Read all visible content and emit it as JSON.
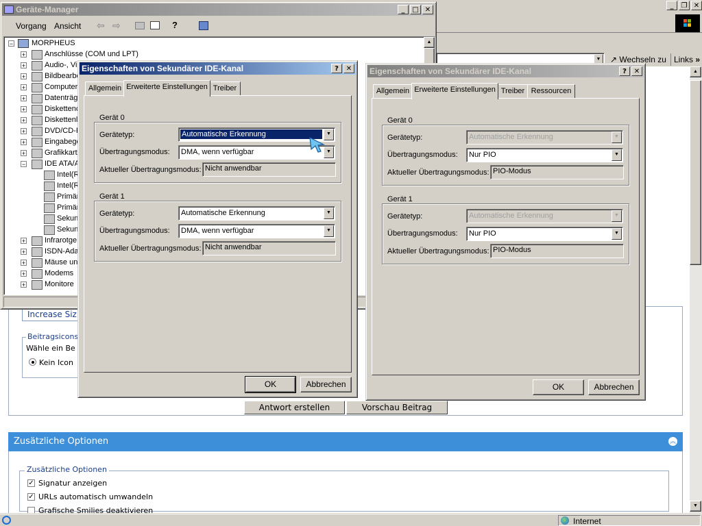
{
  "device_manager": {
    "title": "Geräte-Manager",
    "menu": [
      "Vorgang",
      "Ansicht"
    ],
    "tree": {
      "root": "MORPHEUS",
      "items": [
        "Anschlüsse (COM und LPT)",
        "Audio-, Vi",
        "Bildbearbe",
        "Computer",
        "Datenträg",
        "Diskettenc",
        "Diskettenl",
        "DVD/CD-R",
        "Eingabege",
        "Grafikkart",
        "IDE ATA/A",
        "Intel(R",
        "Intel(R",
        "Primär",
        "Primär",
        "Sekun",
        "Sekun",
        "Infrarotge",
        "ISDN-Ada",
        "Mäuse un",
        "Modems",
        "Monitore"
      ]
    }
  },
  "browser": {
    "address_label": "Wechseln zu",
    "links_label": "Links",
    "status_zone": "Internet"
  },
  "webpage": {
    "increase_size": "Increase Siz",
    "beitrag_group": "Beitragsicons",
    "waehle": "Wähle ein Be",
    "kein_icon": "Kein Icon",
    "antwort_button": "Antwort erstellen",
    "vorschau_button": "Vorschau Beitrag",
    "options_header": "Zusätzliche Optionen",
    "options_group": "Zusätzliche Optionen",
    "signatur": "Signatur anzeigen",
    "urls": "URLs automatisch umwandeln",
    "grafische": "Grafische Smilies deaktivieren"
  },
  "dialog1": {
    "title": "Eigenschaften von Sekundärer IDE-Kanal",
    "tabs": [
      "Allgemein",
      "Erweiterte Einstellungen",
      "Treiber"
    ],
    "device0": {
      "group": "Gerät 0",
      "type_label": "Gerätetyp:",
      "type_value": "Automatische Erkennung",
      "mode_label": "Übertragungsmodus:",
      "mode_value": "DMA, wenn verfügbar",
      "current_label": "Aktueller Übertragungsmodus:",
      "current_value": "Nicht anwendbar"
    },
    "device1": {
      "group": "Gerät 1",
      "type_label": "Gerätetyp:",
      "type_value": "Automatische Erkennung",
      "mode_label": "Übertragungsmodus:",
      "mode_value": "DMA, wenn verfügbar",
      "current_label": "Aktueller Übertragungsmodus:",
      "current_value": "Nicht anwendbar"
    },
    "ok": "OK",
    "cancel": "Abbrechen"
  },
  "dialog2": {
    "title": "Eigenschaften von Sekundärer IDE-Kanal",
    "tabs": [
      "Allgemein",
      "Erweiterte Einstellungen",
      "Treiber",
      "Ressourcen"
    ],
    "device0": {
      "group": "Gerät 0",
      "type_label": "Gerätetyp:",
      "type_value": "Automatische Erkennung",
      "mode_label": "Übertragungsmodus:",
      "mode_value": "Nur PIO",
      "current_label": "Aktueller Übertragungsmodus:",
      "current_value": "PIO-Modus"
    },
    "device1": {
      "group": "Gerät 1",
      "type_label": "Gerätetyp:",
      "type_value": "Automatische Erkennung",
      "mode_label": "Übertragungsmodus:",
      "mode_value": "Nur PIO",
      "current_label": "Aktueller Übertragungsmodus:",
      "current_value": "PIO-Modus"
    },
    "ok": "OK",
    "cancel": "Abbrechen"
  },
  "colors": {
    "title_active": "#0a246a",
    "web_header": "#3c8fd8",
    "face": "#d4d0c8"
  }
}
